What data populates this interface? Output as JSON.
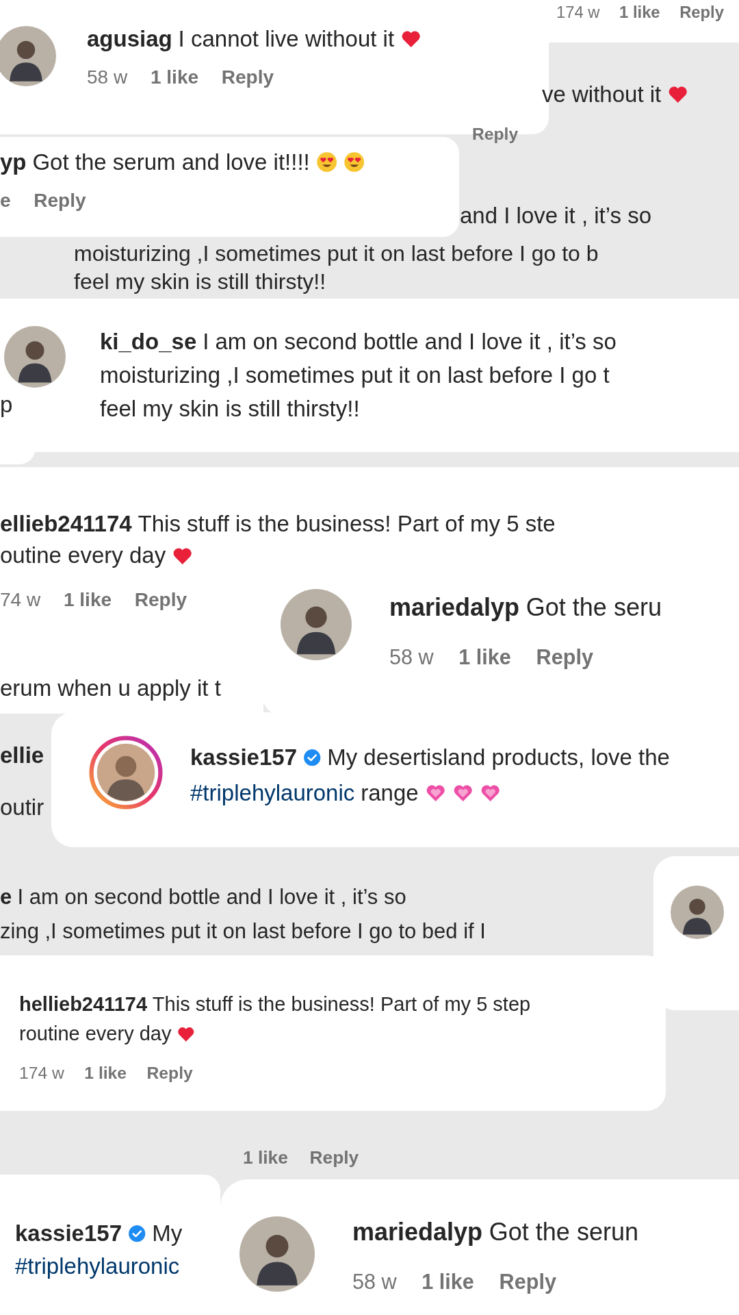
{
  "fragments": [
    {
      "kind": "card",
      "meta": [
        {
          "kind": "time",
          "text": "174 w"
        },
        {
          "kind": "likes",
          "text": "1 like"
        },
        {
          "kind": "reply",
          "text": "Reply"
        }
      ]
    },
    {
      "kind": "card",
      "avatar": {
        "kind": "plain"
      },
      "lines": [
        [
          {
            "kind": "user",
            "text": "agusiag"
          },
          {
            "kind": "text",
            "text": "I cannot live without it"
          },
          {
            "kind": "heart"
          }
        ]
      ],
      "meta": [
        {
          "kind": "time",
          "text": "58 w"
        },
        {
          "kind": "likes",
          "text": "1 like"
        },
        {
          "kind": "reply",
          "text": "Reply"
        }
      ]
    },
    {
      "kind": "ghost",
      "lines": [
        [
          {
            "kind": "text",
            "text": "ve without it"
          },
          {
            "kind": "heart"
          }
        ]
      ]
    },
    {
      "kind": "ghost",
      "meta": [
        {
          "kind": "reply",
          "text": "Reply"
        }
      ]
    },
    {
      "kind": "card",
      "lines": [
        [
          {
            "kind": "user",
            "text": "yp"
          },
          {
            "kind": "text",
            "text": "Got the serum and love it!!!!"
          },
          {
            "kind": "heart-eyes"
          },
          {
            "kind": "heart-eyes"
          }
        ]
      ],
      "meta": [
        {
          "kind": "likes",
          "text": "e"
        },
        {
          "kind": "reply",
          "text": "Reply"
        }
      ]
    },
    {
      "kind": "ghost",
      "lines": [
        [
          {
            "kind": "text",
            "text": "and I love it , it’s so"
          }
        ]
      ]
    },
    {
      "kind": "ghost",
      "lines": [
        [
          {
            "kind": "text",
            "text": "moisturizing ,I sometimes put it on last before I go to b"
          }
        ],
        [
          {
            "kind": "text",
            "text": "feel my skin is still thirsty!!"
          }
        ]
      ]
    },
    {
      "kind": "card",
      "lines": [
        [
          {
            "kind": "text",
            "text": "p"
          }
        ]
      ]
    },
    {
      "kind": "card",
      "avatar": {
        "kind": "plain"
      },
      "lines": [
        [
          {
            "kind": "user",
            "text": "ki_do_se"
          },
          {
            "kind": "text",
            "text": "I am on second bottle and I love it , it’s so"
          }
        ],
        [
          {
            "kind": "text",
            "text": "moisturizing ,I sometimes put it on last before I go t"
          }
        ],
        [
          {
            "kind": "text",
            "text": "feel my skin is still thirsty!!"
          }
        ]
      ]
    },
    {
      "kind": "card",
      "lines": [
        [
          {
            "kind": "user",
            "text": "ellieb241174"
          },
          {
            "kind": "text",
            "text": "This stuff is the business! Part of my 5 ste"
          }
        ],
        [
          {
            "kind": "text",
            "text": "outine every day"
          },
          {
            "kind": "heart"
          }
        ]
      ],
      "meta": [
        {
          "kind": "time",
          "text": "74 w"
        },
        {
          "kind": "likes",
          "text": "1 like"
        },
        {
          "kind": "reply",
          "text": "Reply"
        }
      ]
    },
    {
      "kind": "card",
      "lines": [
        [
          {
            "kind": "text",
            "text": "erum when u apply it t"
          }
        ]
      ]
    },
    {
      "kind": "card",
      "avatar": {
        "kind": "plain"
      },
      "lines": [
        [
          {
            "kind": "user",
            "text": "mariedalyp"
          },
          {
            "kind": "text",
            "text": "Got the seru"
          }
        ]
      ],
      "meta": [
        {
          "kind": "time",
          "text": "58 w"
        },
        {
          "kind": "likes",
          "text": "1 like"
        },
        {
          "kind": "reply",
          "text": "Reply"
        }
      ]
    },
    {
      "kind": "ghost",
      "lines": [
        [
          {
            "kind": "user",
            "text": "ellie"
          }
        ],
        [
          {
            "kind": "text",
            "text": "outir"
          }
        ]
      ]
    },
    {
      "kind": "card",
      "avatar": {
        "kind": "ring"
      },
      "lines": [
        [
          {
            "kind": "user",
            "text": "kassie157"
          },
          {
            "kind": "verified"
          },
          {
            "kind": "text",
            "text": "My desertisland products, love the"
          }
        ],
        [
          {
            "kind": "hashtag",
            "text": "#triplehylauronic"
          },
          {
            "kind": "text",
            "text": "range"
          },
          {
            "kind": "pink-heart"
          },
          {
            "kind": "pink-heart"
          },
          {
            "kind": "pink-heart"
          }
        ]
      ]
    },
    {
      "kind": "ghost",
      "lines": [
        [
          {
            "kind": "user",
            "text": "e"
          },
          {
            "kind": "text",
            "text": "I am on second bottle and I love it , it’s so"
          }
        ],
        [
          {
            "kind": "text",
            "text": "zing ,I sometimes put it on last before I go to bed if I"
          }
        ]
      ]
    },
    {
      "kind": "card",
      "avatar": {
        "kind": "plain"
      }
    },
    {
      "kind": "card",
      "lines": [
        [
          {
            "kind": "user",
            "text": "hellieb241174"
          },
          {
            "kind": "text",
            "text": "This stuff is the business! Part of my 5 step"
          }
        ],
        [
          {
            "kind": "text",
            "text": "routine every day"
          },
          {
            "kind": "heart"
          }
        ]
      ],
      "meta": [
        {
          "kind": "time",
          "text": "174 w"
        },
        {
          "kind": "likes",
          "text": "1 like"
        },
        {
          "kind": "reply",
          "text": "Reply"
        }
      ]
    },
    {
      "kind": "ghost",
      "meta": [
        {
          "kind": "likes",
          "text": "1 like"
        },
        {
          "kind": "reply",
          "text": "Reply"
        }
      ]
    },
    {
      "kind": "card",
      "lines": [
        [
          {
            "kind": "user",
            "text": "kassie157"
          },
          {
            "kind": "verified"
          },
          {
            "kind": "text",
            "text": "My"
          }
        ],
        [
          {
            "kind": "hashtag",
            "text": "#triplehylauronic"
          }
        ]
      ]
    },
    {
      "kind": "card",
      "avatar": {
        "kind": "plain"
      },
      "lines": [
        [
          {
            "kind": "user",
            "text": "mariedalyp"
          },
          {
            "kind": "text",
            "text": "Got the serun"
          }
        ]
      ],
      "meta": [
        {
          "kind": "time",
          "text": "58 w"
        },
        {
          "kind": "likes",
          "text": "1 like"
        },
        {
          "kind": "reply",
          "text": "Reply"
        }
      ]
    }
  ]
}
